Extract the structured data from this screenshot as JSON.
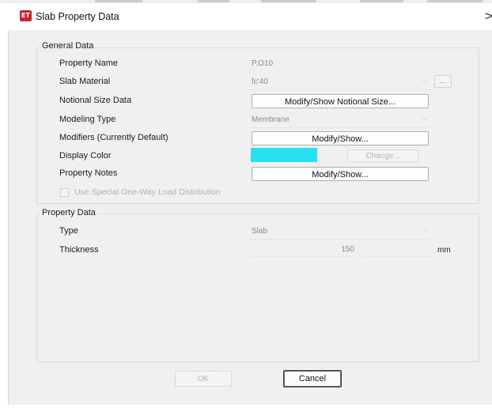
{
  "window": {
    "app_icon_text": "ET",
    "title": "Slab Property Data",
    "close_glyph": ">"
  },
  "general": {
    "title": "General Data",
    "property_name": {
      "label": "Property Name",
      "value": "P.O10"
    },
    "slab_material": {
      "label": "Slab Material",
      "value": "fc'40",
      "ellipsis": "..."
    },
    "notional_size": {
      "label": "Notional Size Data",
      "button": "Modify/Show Notional Size..."
    },
    "modeling_type": {
      "label": "Modeling Type",
      "value": "Membrane"
    },
    "modifiers": {
      "label": "Modifiers (Currently Default)",
      "button": "Modify/Show..."
    },
    "display_color": {
      "label": "Display Color",
      "color": "#27e0ee",
      "button": "Change..."
    },
    "property_notes": {
      "label": "Property Notes",
      "button": "Modify/Show..."
    },
    "one_way_load": {
      "label": "Use Special One-Way Load Distribution",
      "checked": false
    }
  },
  "property": {
    "title": "Property Data",
    "type": {
      "label": "Type",
      "value": "Slab"
    },
    "thickness": {
      "label": "Thickness",
      "value": "150",
      "unit": "mm"
    }
  },
  "buttons": {
    "ok": "OK",
    "cancel": "Cancel"
  }
}
